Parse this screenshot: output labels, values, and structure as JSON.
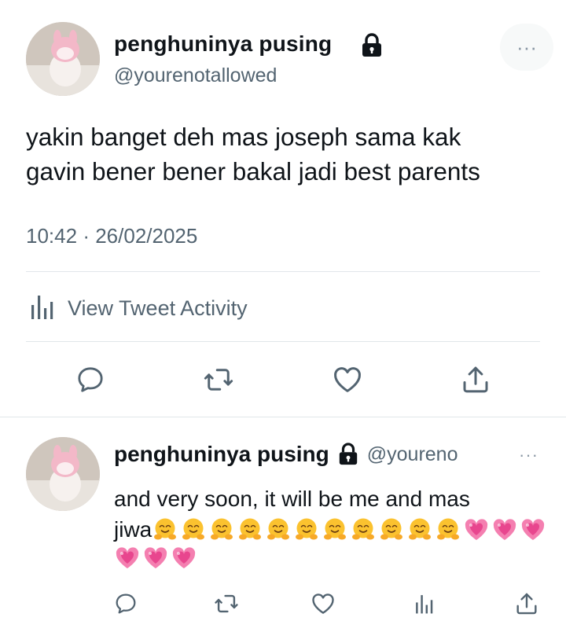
{
  "main_tweet": {
    "display_name": "penghuninya pusing",
    "handle": "@yourenotallowed",
    "text": "yakin banget deh mas joseph sama kak\ngavin bener bener bakal jadi best parents",
    "time": "10:42",
    "date": "26/02/2025",
    "meta_separator": "·",
    "activity_label": "View Tweet Activity",
    "more_icon": "···"
  },
  "reply_tweet": {
    "display_name": "penghuninya pusing",
    "handle": "@youreno",
    "text_line1": "and very soon, it will be me and mas",
    "text_start": "jiwa",
    "more_icon": "···",
    "emojis": [
      "hugging-face",
      "hugging-face",
      "hugging-face",
      "hugging-face",
      "hugging-face",
      "hugging-face",
      "hugging-face",
      "hugging-face",
      "hugging-face",
      "hugging-face",
      "hugging-face",
      "growing-heart",
      "growing-heart",
      "growing-heart",
      "growing-heart",
      "growing-heart",
      "growing-heart"
    ]
  },
  "colors": {
    "text": "#0f1419",
    "secondary": "#536471",
    "divider": "#e1e6ea",
    "icon": "#536471"
  }
}
